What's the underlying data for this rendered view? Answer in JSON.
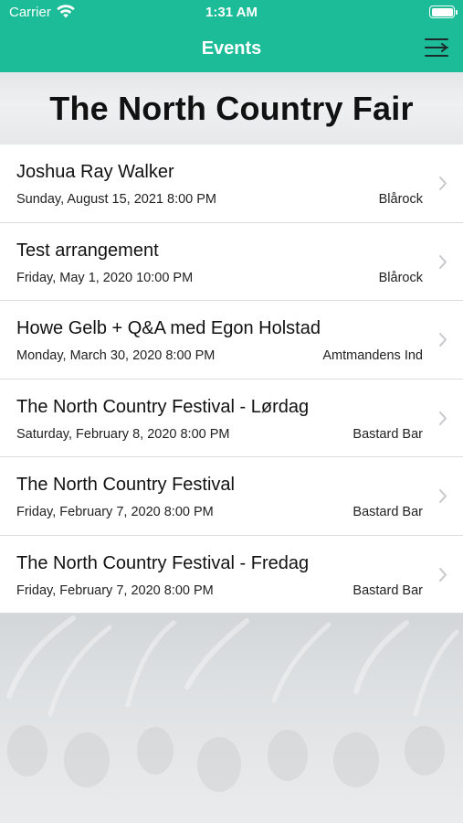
{
  "status_bar": {
    "carrier": "Carrier",
    "time": "1:31 AM",
    "wifi_icon": "wifi-icon",
    "battery_icon": "battery-icon"
  },
  "nav": {
    "title": "Events",
    "menu_icon": "menu-icon"
  },
  "page": {
    "title": "The North Country Fair"
  },
  "events": [
    {
      "title": "Joshua Ray Walker",
      "date": "Sunday, August 15, 2021 8:00 PM",
      "venue": "Blårock"
    },
    {
      "title": "Test arrangement",
      "date": "Friday, May 1, 2020 10:00 PM",
      "venue": "Blårock"
    },
    {
      "title": "Howe Gelb + Q&A med Egon Holstad",
      "date": "Monday, March 30, 2020 8:00 PM",
      "venue": "Amtmandens Ind"
    },
    {
      "title": "The North Country Festival - Lørdag",
      "date": "Saturday, February 8, 2020 8:00 PM",
      "venue": "Bastard Bar"
    },
    {
      "title": "The North Country Festival",
      "date": "Friday, February 7, 2020 8:00 PM",
      "venue": "Bastard Bar"
    },
    {
      "title": "The North Country Festival - Fredag",
      "date": "Friday, February 7, 2020 8:00 PM",
      "venue": "Bastard Bar"
    }
  ],
  "colors": {
    "accent": "#1dbc98",
    "chevron": "#c7c7cc"
  }
}
